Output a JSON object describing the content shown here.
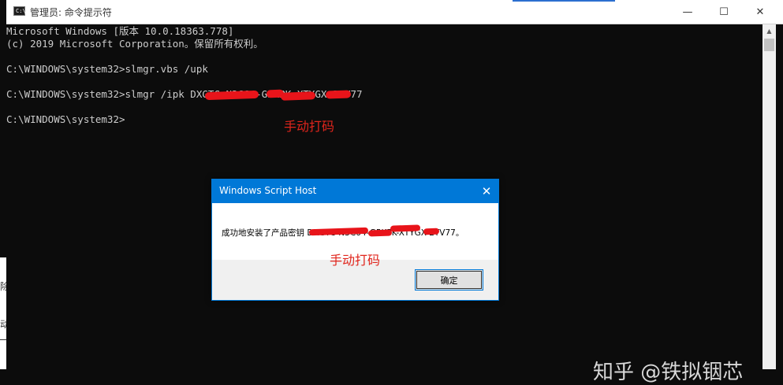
{
  "background_window": {
    "fragment1": "除",
    "fragment2": "动"
  },
  "console": {
    "title": "管理员: 命令提示符",
    "controls": {
      "minimize": "—",
      "maximize": "☐",
      "close": "✕"
    },
    "lines": [
      "Microsoft Windows [版本 10.0.18363.778]",
      "(c) 2019 Microsoft Corporation。保留所有权利。",
      "C:\\WINDOWS\\system32>slmgr.vbs /upk",
      "C:\\WINDOWS\\system32>slmgr /ipk DXGTC-N3C64-G5KPK-XTYGX-2YV77",
      "C:\\WINDOWS\\system32>"
    ],
    "annotation": "手动打码"
  },
  "dialog": {
    "title": "Windows Script Host",
    "close": "✕",
    "message": "成功地安装了产品密钥 DXGTC-N3C64-G5KPK-XTYGX-2YV77。",
    "annotation": "手动打码",
    "ok_label": "确定"
  },
  "watermark": "知乎 @铁拟铟芯",
  "colors": {
    "accent": "#0078d7",
    "redaction": "#e8141a",
    "console_bg": "#0c0c0c",
    "console_text": "#cccccc"
  }
}
